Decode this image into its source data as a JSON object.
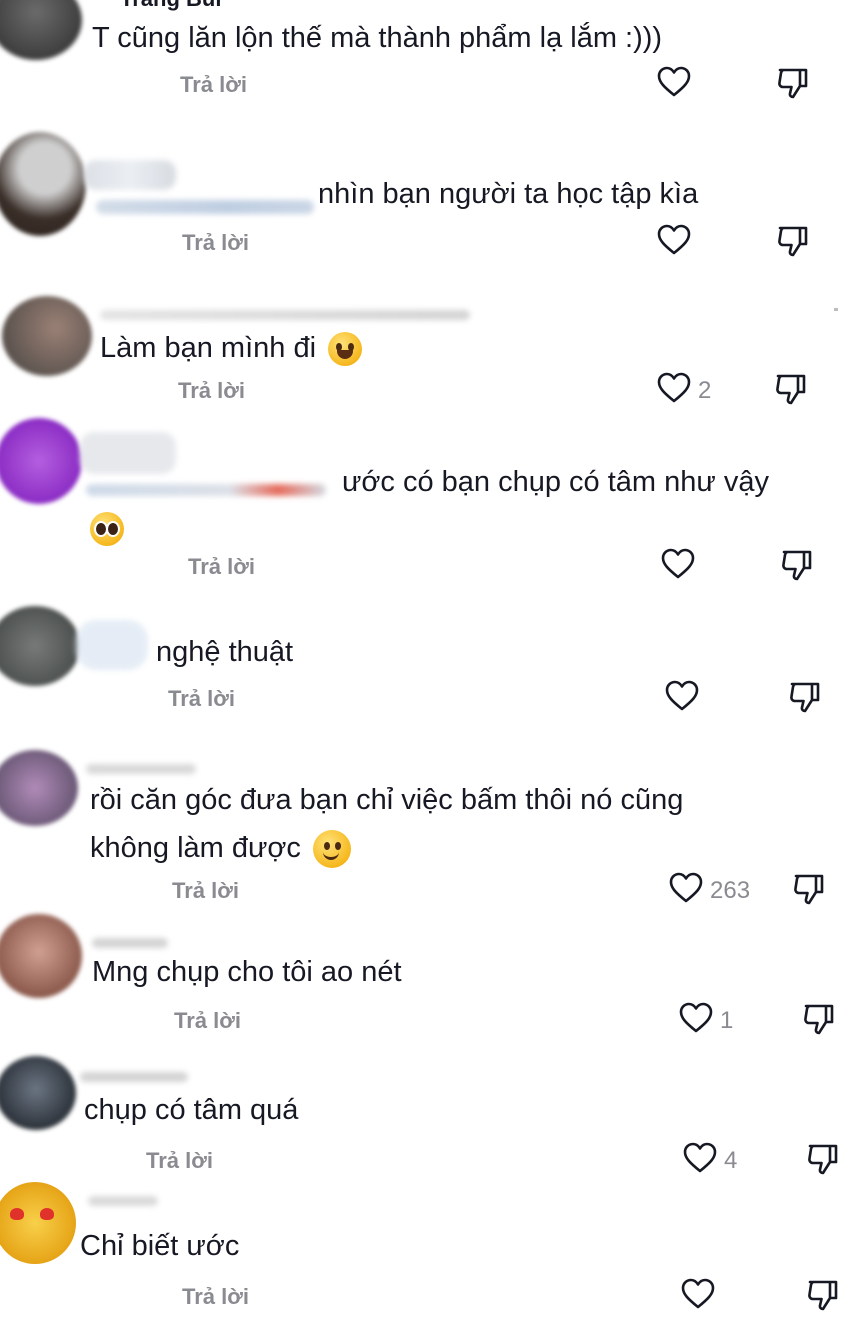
{
  "reply_label": "Trả lời",
  "colors": {
    "text": "#161823",
    "muted": "#8a8b91"
  },
  "comments": [
    {
      "name_fragment": "Trang Bui",
      "text": "T cũng lăn lộn thế mà thành phẩm lạ lắm :)))",
      "likes": ""
    },
    {
      "text": "nhìn bạn người ta học tập kìa",
      "likes": ""
    },
    {
      "text": "Làm bạn mình đi",
      "emoji": "face-with-tears-of-joy",
      "likes": "2"
    },
    {
      "text": "ước có bạn chụp có tâm như vậy",
      "emoji": "pleading-face",
      "likes": ""
    },
    {
      "text": "nghệ thuật",
      "likes": ""
    },
    {
      "text_line1": "rồi căn góc đưa bạn chỉ việc bấm thôi nó cũng",
      "text_line2": "không làm được",
      "emoji": "slightly-smiling-face",
      "likes": "263"
    },
    {
      "text": "Mng chụp cho tôi ao nét",
      "likes": "1"
    },
    {
      "text": "chụp có tâm quá",
      "likes": "4"
    },
    {
      "text": "Chỉ biết ước",
      "likes": ""
    }
  ]
}
